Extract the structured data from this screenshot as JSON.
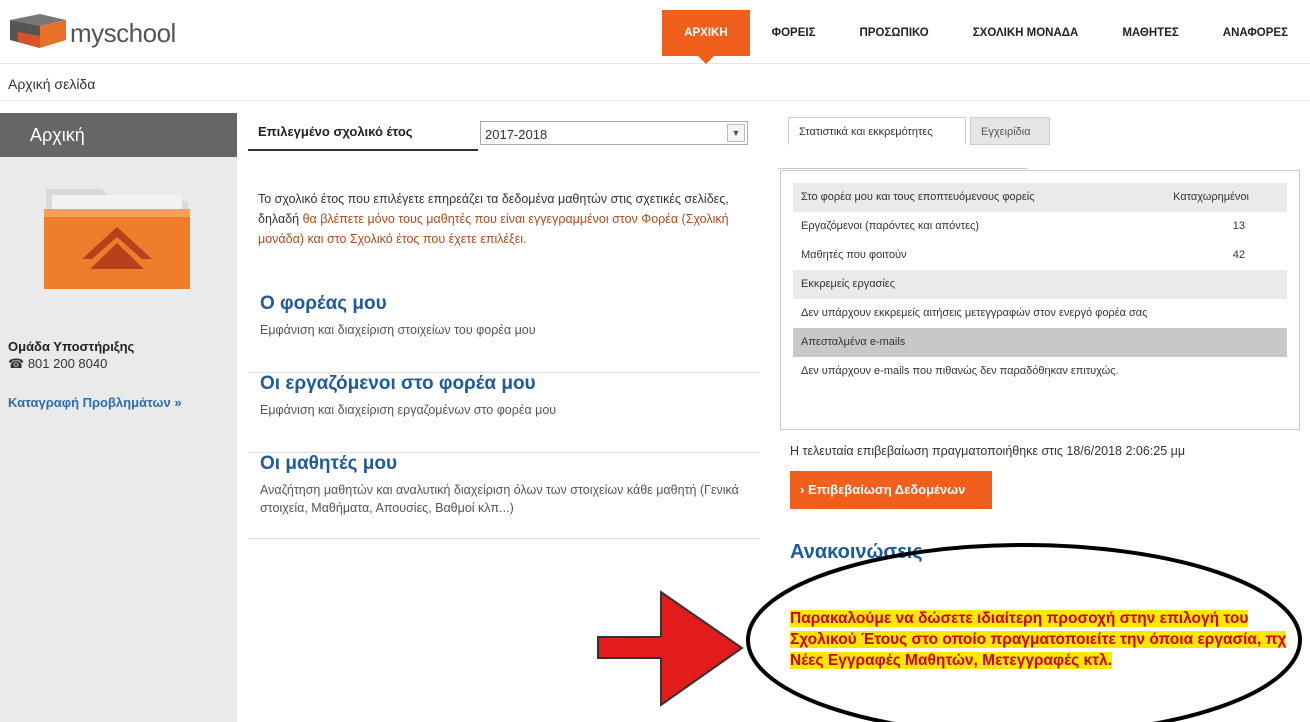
{
  "brand": {
    "name": "myschool",
    "name_prefix": "my",
    "name_suffix": "school"
  },
  "nav": [
    {
      "label": "ΑΡΧΙΚΗ",
      "active": true
    },
    {
      "label": "ΦΟΡΕΙΣ"
    },
    {
      "label": "ΠΡΟΣΩΠΙΚΟ"
    },
    {
      "label": "ΣΧΟΛΙΚΗ ΜΟΝΑΔΑ"
    },
    {
      "label": "ΜΑΘΗΤΕΣ"
    },
    {
      "label": "ΑΝΑΦΟΡΕΣ"
    }
  ],
  "breadcrumb": "Αρχική σελίδα",
  "sidebar": {
    "title": "Αρχική",
    "support_title": "Ομάδα Υποστήριξης",
    "support_phone": "801 200 8040",
    "problems_link": "Καταγραφή Προβλημάτων »"
  },
  "main": {
    "year_label": "Επιλεγμένο σχολικό έτος",
    "year_value": "2017-2018",
    "info_plain": "Το σχολικό έτος που επιλέγετε επηρεάζει τα δεδομένα μαθητών στις σχετικές σελίδες, δηλαδή ",
    "info_highlight": "θα βλέπετε μόνο τους μαθητές που είναι εγγεγραμμένοι στον Φορέα (Σχολική μονάδα) και στο Σχολικό έτος που έχετε επιλέξει.",
    "sections": [
      {
        "title": "Ο φορέας μου",
        "desc": "Εμφάνιση και διαχείριση στοιχείων του φορέα μου"
      },
      {
        "title": "Οι εργαζόμενοι στο φορέα μου",
        "desc": "Εμφάνιση και διαχείριση εργαζομένων στο φορέα μου"
      },
      {
        "title": "Οι μαθητές μου",
        "desc": "Αναζήτηση μαθητών και αναλυτική διαχείριση όλων των στοιχείων κάθε μαθητή (Γενικά στοιχεία, Μαθήματα, Απουσίες, Βαθμοί κλπ...)"
      }
    ]
  },
  "right": {
    "tab_stats": "Στατιστικά και εκκρεμότητες",
    "tab_manuals": "Εγχειρίδια",
    "stats_header": "Στο φορέα μου και τους εποπτευόμενους φορείς",
    "stats_header_value": "Καταχωρημένοι",
    "employees_label": "Εργαζόμενοι (παρόντες και απόντες)",
    "employees_value": "13",
    "students_label": "Μαθητές που φοιτούν",
    "students_value": "42",
    "pending_header": "Εκκρεμείς εργασίες",
    "pending_text": "Δεν υπάρχουν εκκρεμείς αιτήσεις μετεγγραφών στον ενεργό φορέα σας",
    "emails_header": "Απεσταλμένα e-mails",
    "emails_text": "Δεν υπάρχουν e-mails που πιθανώς δεν παραδόθηκαν επιτυχώς.",
    "last_confirm": "Η τελευταία επιβεβαίωση πραγματοποιήθηκε στις 18/6/2018 2:06:25 μμ",
    "confirm_button": "› Επιβεβαίωση Δεδομένων",
    "announcements_title": "Ανακοινώσεις",
    "notice": "Παρακαλούμε να δώσετε ιδιαίτερη προσοχή στην επιλογή του Σχολικού Έτους στο οποίο πραγματοποιείτε την όποια εργασία, πχ Νέες Εγγραφές Μαθητών, Μετεγγραφές κτλ."
  },
  "colors": {
    "accent": "#f0601c",
    "link": "#1f5a9c",
    "notice_bg": "#ffe800",
    "notice_fg": "#d40000",
    "arrow": "#e02020"
  }
}
